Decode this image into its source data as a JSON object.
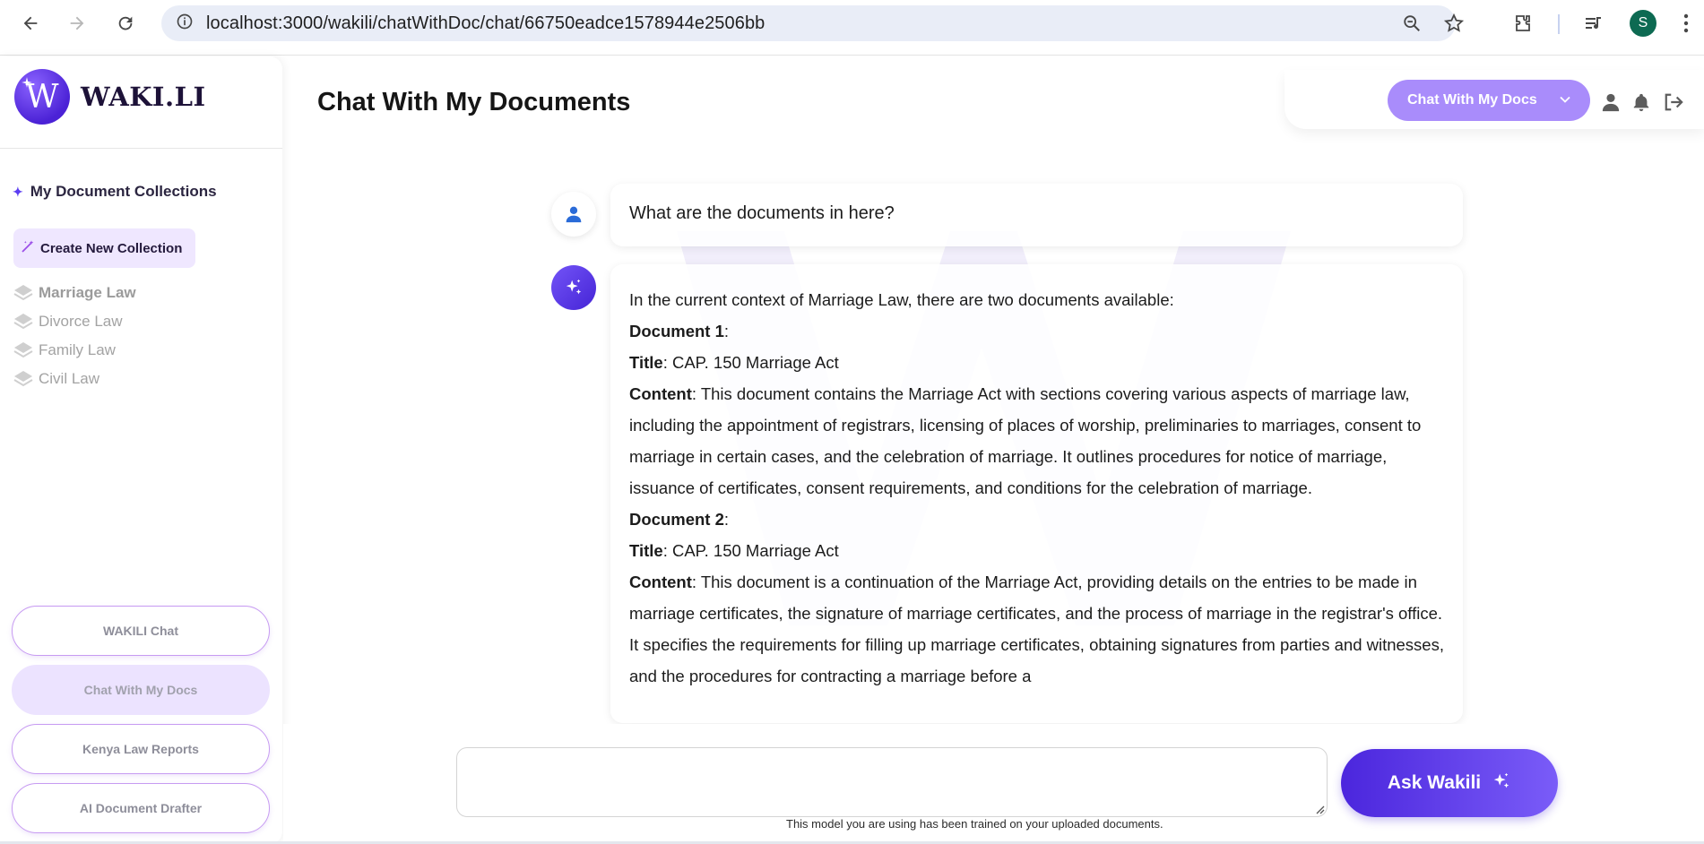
{
  "browser": {
    "url": "localhost:3000/wakili/chatWithDoc/chat/66750eadce1578944e2506bb",
    "profile_initial": "S"
  },
  "sidebar": {
    "brand_letter": "W",
    "brand_name": "WAKI.LI",
    "collections_heading": "My Document Collections",
    "create_button": "Create New Collection",
    "collections": [
      {
        "label": "Marriage Law",
        "active": true
      },
      {
        "label": "Divorce Law",
        "active": false
      },
      {
        "label": "Family Law",
        "active": false
      },
      {
        "label": "Civil Law",
        "active": false
      }
    ],
    "nav_buttons": [
      {
        "label": "WAKILI Chat",
        "active": false
      },
      {
        "label": "Chat With My Docs",
        "active": true
      },
      {
        "label": "Kenya Law Reports",
        "active": false
      },
      {
        "label": "AI Document Drafter",
        "active": false
      }
    ]
  },
  "header": {
    "title": "Chat With My Documents",
    "mode_dropdown": "Chat With My Docs"
  },
  "chat": {
    "user_message": "What are the documents in here?",
    "bot_intro": "In the current context of Marriage Law, there are two documents available:",
    "documents": [
      {
        "heading": "Document 1",
        "title_label": "Title",
        "title_value": ": CAP. 150 Marriage Act",
        "content_label": "Content",
        "content_value": ": This document contains the Marriage Act with sections covering various aspects of marriage law, including the appointment of registrars, licensing of places of worship, preliminaries to marriages, consent to marriage in certain cases, and the celebration of marriage. It outlines procedures for notice of marriage, issuance of certificates, consent requirements, and conditions for the celebration of marriage."
      },
      {
        "heading": "Document 2",
        "title_label": "Title",
        "title_value": ": CAP. 150 Marriage Act",
        "content_label": "Content",
        "content_value": ": This document is a continuation of the Marriage Act, providing details on the entries to be made in marriage certificates, the signature of marriage certificates, and the process of marriage in the registrar's office. It specifies the requirements for filling up marriage certificates, obtaining signatures from parties and witnesses, and the procedures for contracting a marriage before a"
      }
    ]
  },
  "composer": {
    "input_value": "",
    "ask_button": "Ask Wakili",
    "disclaimer": "This model you are using has been trained on your uploaded documents."
  },
  "colors": {
    "accent": "#5b3df2",
    "accent_light": "#a98cfb",
    "active_nav_bg": "#ece3ff"
  }
}
